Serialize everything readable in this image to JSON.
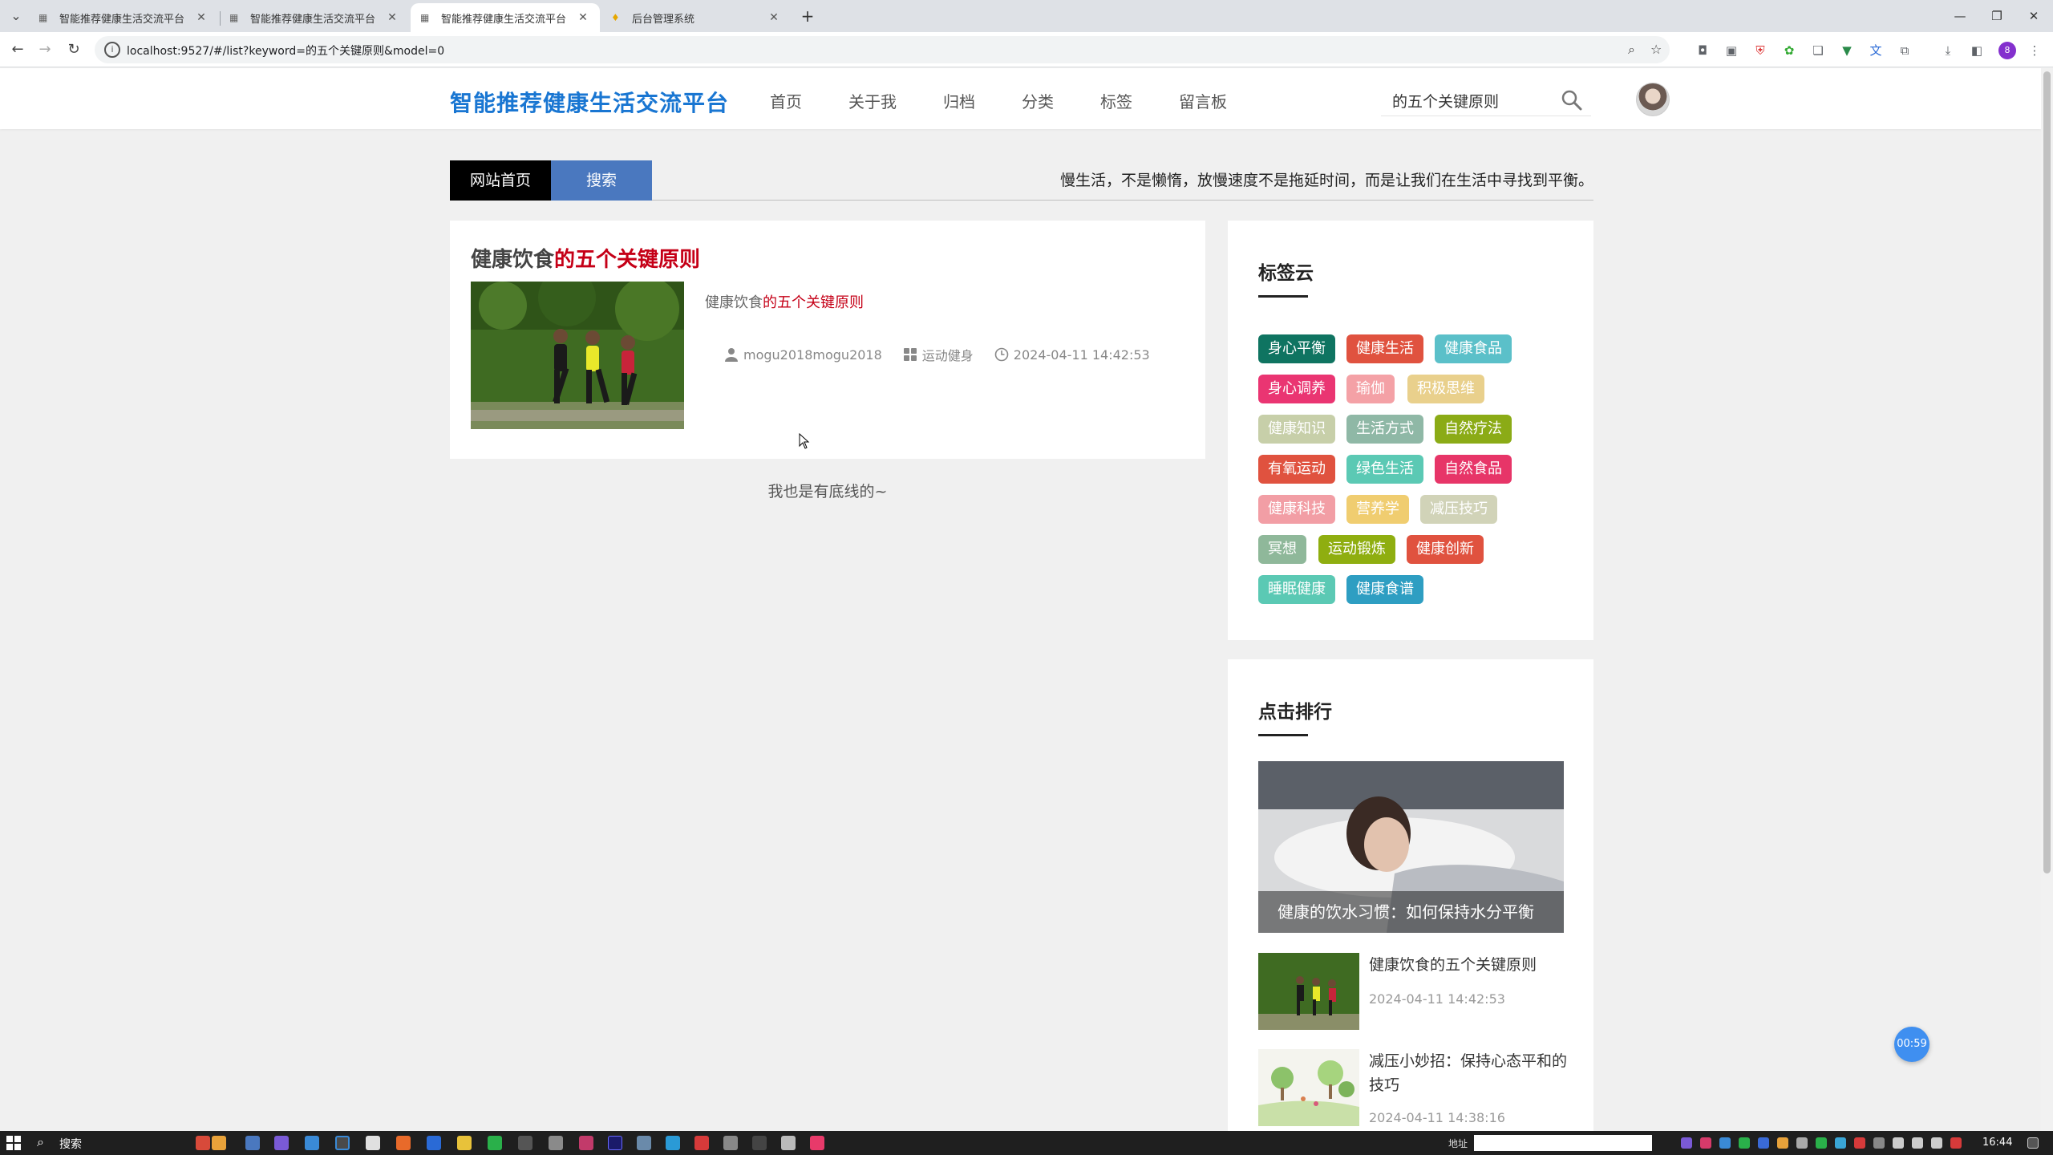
{
  "browser": {
    "tabs": [
      {
        "label": "智能推荐健康生活交流平台",
        "active": false
      },
      {
        "label": "智能推荐健康生活交流平台",
        "active": false
      },
      {
        "label": "智能推荐健康生活交流平台",
        "active": true
      },
      {
        "label": "后台管理系统",
        "active": false
      }
    ],
    "url": "localhost:9527/#/list?keyword=的五个关键原则&model=0"
  },
  "header": {
    "logo": "智能推荐健康生活交流平台",
    "nav": [
      "首页",
      "关于我",
      "归档",
      "分类",
      "标签",
      "留言板"
    ],
    "search_value": "的五个关键原则"
  },
  "crumbs": {
    "home": "网站首页",
    "search": "搜索"
  },
  "motto": "慢生活，不是懒惰，放慢速度不是拖延时间，而是让我们在生活中寻找到平衡。",
  "result": {
    "title_plain": "健康饮食",
    "title_highlight": "的五个关键原则",
    "summary_plain": "健康饮食",
    "summary_highlight": "的五个关键原则",
    "author": "mogu2018mogu2018",
    "category": "运动健身",
    "date": "2024-04-11 14:42:53"
  },
  "bottom_note": "我也是有底线的~",
  "tag_cloud": {
    "title": "标签云",
    "tags": [
      {
        "label": "身心平衡",
        "color": "#0f7461"
      },
      {
        "label": "健康生活",
        "color": "#e0523f"
      },
      {
        "label": "健康食品",
        "color": "#5bc0c9"
      },
      {
        "label": "身心调养",
        "color": "#ea3572"
      },
      {
        "label": "瑜伽",
        "color": "#f4a1a6"
      },
      {
        "label": "积极思维",
        "color": "#e9d08c"
      },
      {
        "label": "健康知识",
        "color": "#c7cfa9"
      },
      {
        "label": "生活方式",
        "color": "#8fb8a6"
      },
      {
        "label": "自然疗法",
        "color": "#8bab16"
      },
      {
        "label": "有氧运动",
        "color": "#e0523f"
      },
      {
        "label": "绿色生活",
        "color": "#5bc9b4"
      },
      {
        "label": "自然食品",
        "color": "#e73568"
      },
      {
        "label": "健康科技",
        "color": "#f29ea5"
      },
      {
        "label": "营养学",
        "color": "#f0cd70"
      },
      {
        "label": "减压技巧",
        "color": "#d1d3b8"
      },
      {
        "label": "冥想",
        "color": "#8fb89a"
      },
      {
        "label": "运动锻炼",
        "color": "#8fae10"
      },
      {
        "label": "健康创新",
        "color": "#e0523f"
      },
      {
        "label": "睡眠健康",
        "color": "#5bc9b4"
      },
      {
        "label": "健康食谱",
        "color": "#2e9ec2"
      }
    ]
  },
  "ranking": {
    "title": "点击排行",
    "hero_caption": "健康的饮水习惯：如何保持水分平衡",
    "items": [
      {
        "title": "健康饮食的五个关键原则",
        "date": "2024-04-11 14:42:53"
      },
      {
        "title": "减压小妙招：保持心态平和的技巧",
        "date": "2024-04-11 14:38:16"
      }
    ]
  },
  "timer": "00:59",
  "taskbar": {
    "search": "搜索",
    "address_label": "地址",
    "time": "16:44"
  }
}
